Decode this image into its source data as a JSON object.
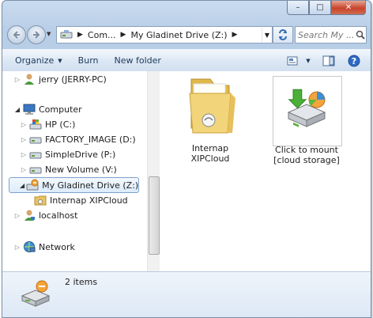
{
  "window": {
    "caption_buttons": {
      "minimize": "–",
      "maximize": "□",
      "close": "✕"
    }
  },
  "address": {
    "crumbs": [
      "Com...",
      "My Gladinet Drive (Z:)"
    ],
    "search_placeholder": "Search My ..."
  },
  "toolbar": {
    "organize": "Organize",
    "burn": "Burn",
    "new_folder": "New folder"
  },
  "nav": {
    "items": [
      {
        "label": "jerry (JERRY-PC)"
      },
      {
        "label": "Computer"
      },
      {
        "label": "HP (C:)"
      },
      {
        "label": "FACTORY_IMAGE (D:)"
      },
      {
        "label": "SimpleDrive (P:)"
      },
      {
        "label": "New Volume (V:)"
      },
      {
        "label": "My Gladinet Drive (Z:)"
      },
      {
        "label": "Internap XIPCloud"
      },
      {
        "label": "localhost"
      },
      {
        "label": "Network"
      }
    ]
  },
  "content": {
    "files": [
      {
        "line1": "Internap",
        "line2": "XIPCloud"
      },
      {
        "line1": "Click to mount",
        "line2": "[cloud storage]"
      }
    ]
  },
  "status": {
    "items_text": "2 items"
  },
  "colors": {
    "selection_border": "#7da2ce",
    "toolbar_text": "#1e395b",
    "close_button": "#c7432a"
  }
}
